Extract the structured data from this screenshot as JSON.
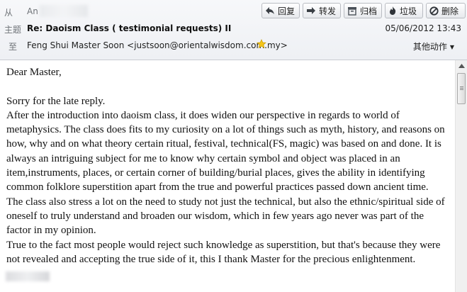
{
  "header": {
    "from_label": "从",
    "from_name": "An",
    "subject_label": "主题",
    "subject": "Re: Daoism Class ( testimonial requests) II",
    "date": "05/06/2012 13:43",
    "to_label": "至",
    "to": "Feng Shui Master Soon <justsoon@orientalwisdom.com.my>",
    "other_actions": "其他动作"
  },
  "toolbar": {
    "reply": "回复",
    "forward": "转发",
    "archive": "归档",
    "junk": "垃圾",
    "delete": "删除"
  },
  "message": {
    "text": "Dear Master,\n\nSorry for the late reply.\nAfter the introduction into daoism class, it does widen our perspective in regards to world of\nmetaphysics. The class does fits to my curiosity on a lot of things such as myth, history, and reasons on\nhow, why and on what theory certain ritual, festival, technical(FS, magic) was based on and done. It is\nalways an intriguing subject for me to know why certain symbol and object was placed in an\nitem,instruments, places, or certain corner of building/burial places, gives the ability in identifying\ncommon folklore superstition apart from the true and powerful practices passed down ancient time.\nThe class also stress a lot on the need to study not just the technical, but also the ethnic/spiritual side of\noneself to truly understand and broaden our wisdom, which in few years ago never was part of the\nfactor in my opinion.\nTrue to the fact most people would reject such knowledge as superstition, but that's because they were\nnot revealed and accepting the true side of it, this I thank Master for the precious enlightenment."
  },
  "icons": {
    "reply": "reply-arrow-icon",
    "forward": "forward-arrow-icon",
    "archive": "archive-box-icon",
    "junk": "flame-icon",
    "delete": "no-entry-icon",
    "star": "star-icon"
  },
  "colors": {
    "header_bg": "#eef0f4",
    "border": "#c9ccd2",
    "star": "#f5c518"
  }
}
